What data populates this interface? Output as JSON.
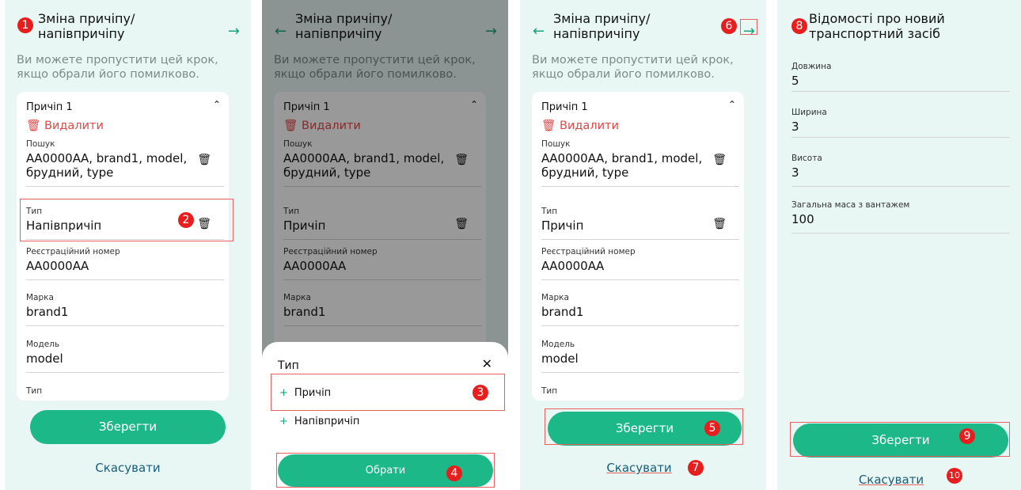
{
  "screen1": {
    "title": "Зміна причіпу/ напівпричіпу",
    "hint": "Ви можете пропустити цей крок, якщо обрали його помилково.",
    "card_title": "Причіп 1",
    "delete": "Видалити",
    "fields": [
      {
        "label": "Пошук",
        "value": "АА0000АА, brand1, model, брудний, type"
      },
      {
        "label": "Тип",
        "value": "Напівпричіп"
      },
      {
        "label": "Реєстраційний номер",
        "value": "АА0000АА"
      },
      {
        "label": "Марка",
        "value": "brand1"
      },
      {
        "label": "Модель",
        "value": "model"
      },
      {
        "label": "Тип",
        "value": ""
      }
    ],
    "save": "Зберегти",
    "cancel": "Скасувати"
  },
  "screen2": {
    "title": "Зміна причіпу/ напівпричіпу",
    "hint": "Ви можете пропустити цей крок, якщо обрали його помилково.",
    "card_title": "Причіп 1",
    "delete": "Видалити",
    "fields": [
      {
        "label": "Пошук",
        "value": "АА0000АА, brand1, model, брудний, type"
      },
      {
        "label": "Тип",
        "value": "Причіп"
      },
      {
        "label": "Реєстраційний номер",
        "value": "АА0000АА"
      },
      {
        "label": "Марка",
        "value": "brand1"
      }
    ],
    "sheet_title": "Тип",
    "options": [
      "Причіп",
      "Напівпричіп"
    ],
    "select": "Обрати"
  },
  "screen3": {
    "title": "Зміна причіпу/ напівпричіпу",
    "hint": "Ви можете пропустити цей крок, якщо обрали його помилково.",
    "card_title": "Причіп 1",
    "delete": "Видалити",
    "fields": [
      {
        "label": "Пошук",
        "value": "АА0000АА, brand1, model, брудний, type"
      },
      {
        "label": "Тип",
        "value": "Причіп"
      },
      {
        "label": "Реєстраційний номер",
        "value": "АА0000АА"
      },
      {
        "label": "Марка",
        "value": "brand1"
      },
      {
        "label": "Модель",
        "value": "model"
      },
      {
        "label": "Тип",
        "value": ""
      }
    ],
    "save": "Зберегти",
    "cancel": "Скасувати"
  },
  "screen4": {
    "title": "Відомості про новий транспортний засіб",
    "fields": [
      {
        "label": "Довжина",
        "value": "5"
      },
      {
        "label": "Ширина",
        "value": "3"
      },
      {
        "label": "Висота",
        "value": "3"
      },
      {
        "label": "Загальна маса з вантажем",
        "value": "100"
      }
    ],
    "save": "Зберегти",
    "cancel": "Скасувати"
  },
  "badges": [
    "1",
    "2",
    "3",
    "4",
    "5",
    "6",
    "7",
    "8",
    "9",
    "10"
  ],
  "icons": {
    "back": "arrow-left-icon",
    "forward": "arrow-right-icon",
    "trash": "trash-icon",
    "chevron": "chevron-up-icon",
    "close": "close-icon",
    "plus": "plus-icon"
  },
  "colors": {
    "accent": "#1cb887",
    "panel": "#e8f7f4",
    "danger": "#e04848",
    "badge": "#e81e1e"
  }
}
